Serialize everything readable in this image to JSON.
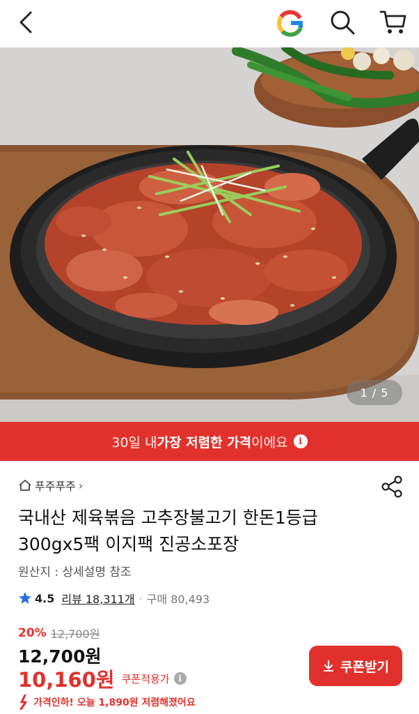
{
  "header": {
    "back_icon": "chevron-left-icon",
    "logo_letter": "G",
    "search_icon": "search-icon",
    "cart_icon": "cart-icon",
    "logo_colors": [
      "#e53935",
      "#fbc02d",
      "#43a047",
      "#1e88e5"
    ]
  },
  "gallery": {
    "current": "1",
    "separator": "/",
    "total": "5",
    "current_index": 1,
    "total_images": 5
  },
  "promo": {
    "prefix": "30일 내 ",
    "highlight": "가장 저렴한 가격",
    "suffix": "이에요",
    "info_glyph": "i",
    "background": "#e2312c"
  },
  "product": {
    "seller_name": "푸주푸주",
    "seller_chevron": "›",
    "title_line1": "국내산 제육볶음 고추장불고기 한돈1등급",
    "title_line2": "300gx5팩 이지팩 진공소포장",
    "origin": "원산지 : 상세설명 참조",
    "rating": "4.5",
    "review_text": "리뷰 18,311개",
    "purchase_text": "구매 80,493",
    "rating_value": 4.5
  },
  "price": {
    "discount_percent": "20%",
    "original_price": "12,700원",
    "sale_price": "12,700원",
    "coupon_price": "10,160원",
    "coupon_label": "쿠폰적용가",
    "coupon_info_glyph": "i",
    "price_drop_text": "가격인하! 오늘 1,890원 저렴해졌어요",
    "coupon_button_label": "쿠폰받기",
    "accent_color": "#e2312c"
  }
}
